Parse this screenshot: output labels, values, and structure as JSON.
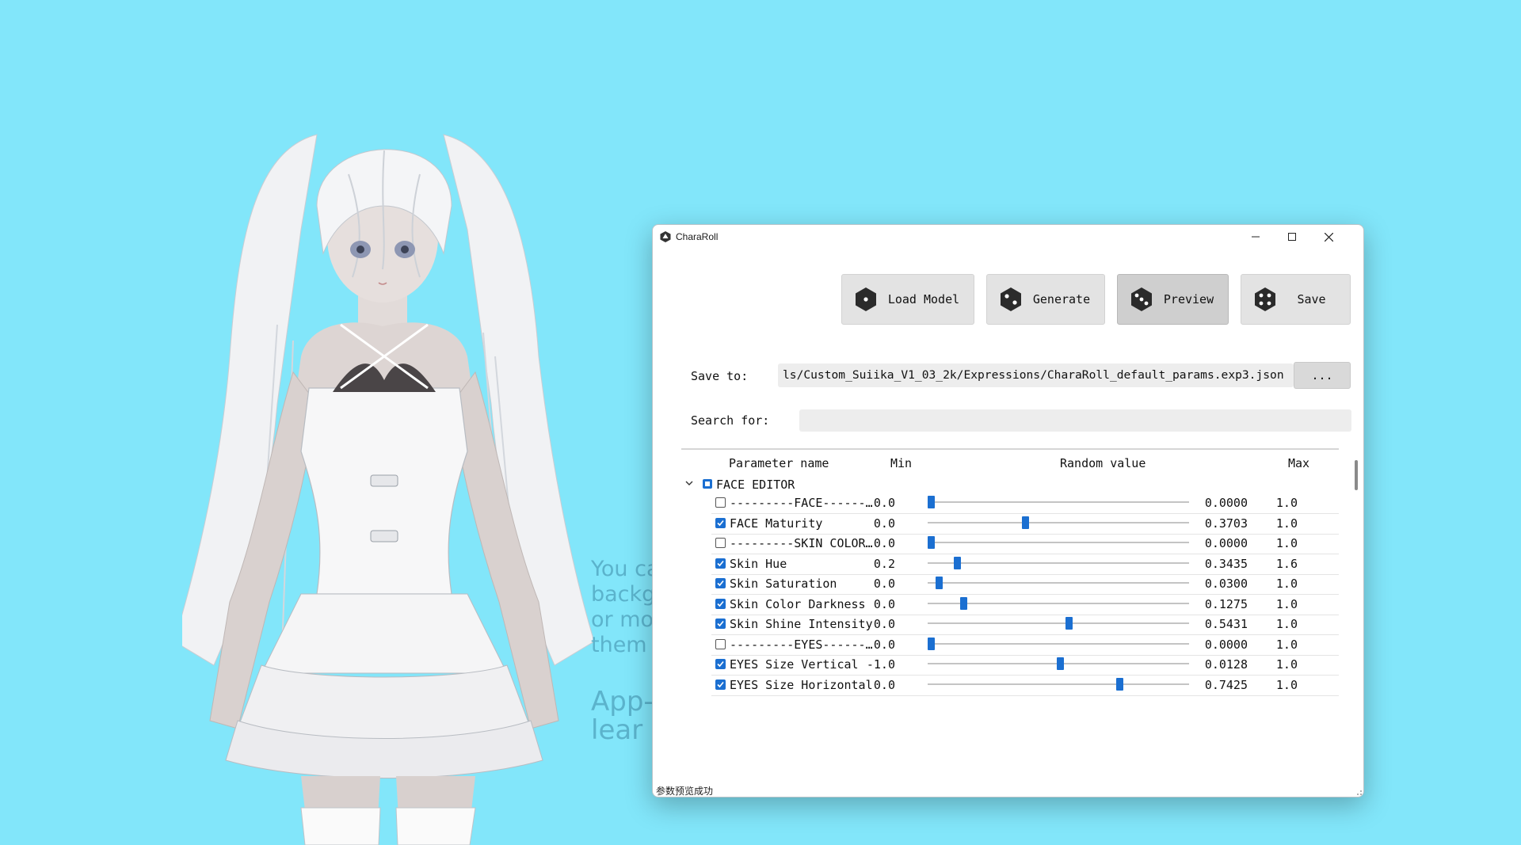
{
  "background": {
    "color": "#82e6fa",
    "hint_lines": [
      "You ca",
      "backgr",
      "or mov",
      "them i"
    ],
    "hint_app_lines": [
      "App-",
      "lear"
    ]
  },
  "window": {
    "title": "CharaRoll",
    "icon": "d20-icon",
    "controls": [
      "minimize",
      "maximize",
      "close"
    ]
  },
  "toolbar": {
    "buttons": [
      {
        "id": "load",
        "label": "Load Model",
        "icon": "die-one-icon",
        "pressed": false
      },
      {
        "id": "generate",
        "label": "Generate",
        "icon": "die-two-icon",
        "pressed": false
      },
      {
        "id": "preview",
        "label": "Preview",
        "icon": "die-three-icon",
        "pressed": true
      },
      {
        "id": "save",
        "label": "Save",
        "icon": "die-four-icon",
        "pressed": false
      }
    ]
  },
  "save_to": {
    "label": "Save to:",
    "value": "ls/Custom_Suiika_V1_03_2k/Expressions/CharaRoll_default_params.exp3.json",
    "browse_label": "..."
  },
  "search": {
    "label": "Search for:",
    "value": ""
  },
  "table": {
    "headers": {
      "name": "Parameter name",
      "min": "Min",
      "random": "Random value",
      "max": "Max"
    },
    "group": {
      "label": "FACE EDITOR",
      "expanded": true,
      "checked": "partial"
    },
    "rows": [
      {
        "checked": false,
        "name": "---------FACE------…",
        "min": "0.0",
        "value": "0.0000",
        "max": "1.0",
        "fraction": 0.0
      },
      {
        "checked": true,
        "name": "FACE Maturity",
        "min": "0.0",
        "value": "0.3703",
        "max": "1.0",
        "fraction": 0.3703
      },
      {
        "checked": false,
        "name": "---------SKIN COLOR…",
        "min": "0.0",
        "value": "0.0000",
        "max": "1.0",
        "fraction": 0.0
      },
      {
        "checked": true,
        "name": "Skin Hue",
        "min": "0.2",
        "value": "0.3435",
        "max": "1.6",
        "fraction": 0.1025
      },
      {
        "checked": true,
        "name": "Skin Saturation",
        "min": "0.0",
        "value": "0.0300",
        "max": "1.0",
        "fraction": 0.03
      },
      {
        "checked": true,
        "name": "Skin Color Darkness",
        "min": "0.0",
        "value": "0.1275",
        "max": "1.0",
        "fraction": 0.1275
      },
      {
        "checked": true,
        "name": "Skin Shine Intensity",
        "min": "0.0",
        "value": "0.5431",
        "max": "1.0",
        "fraction": 0.5431
      },
      {
        "checked": false,
        "name": "---------EYES------…",
        "min": "0.0",
        "value": "0.0000",
        "max": "1.0",
        "fraction": 0.0
      },
      {
        "checked": true,
        "name": "EYES Size Vertical",
        "min": "-1.0",
        "value": "0.0128",
        "max": "1.0",
        "fraction": 0.5064
      },
      {
        "checked": true,
        "name": "EYES Size Horizontal",
        "min": "0.0",
        "value": "0.7425",
        "max": "1.0",
        "fraction": 0.7425
      }
    ]
  },
  "status": {
    "message": "参数预览成功"
  },
  "colors": {
    "accent": "#1b6fd1",
    "button": "#e3e3e3",
    "button_pressed": "#cfcfcf",
    "field": "#ededed"
  }
}
